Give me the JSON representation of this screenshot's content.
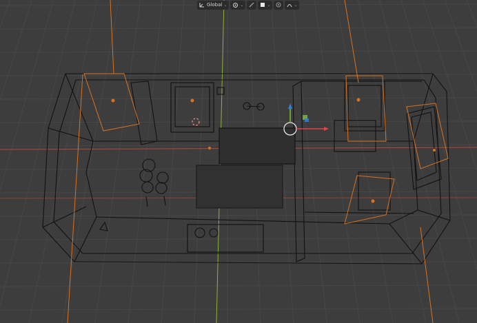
{
  "header": {
    "transform_orientation": {
      "label": "Global",
      "icon": "transform-orientation-icon"
    },
    "pivot_point": {
      "icon": "pivot-point-icon"
    },
    "snapping": {
      "icons": [
        "snap-toggle-icon",
        "snap-target-icon"
      ]
    },
    "proportional_editing": {
      "icons": [
        "proportional-editing-icon",
        "falloff-icon"
      ]
    }
  },
  "viewport": {
    "shading": "wireframe",
    "background": "#3d3d3d",
    "grid_color": "#474747",
    "axis_x_color": "#c8423d",
    "axis_y_color": "#8fb33a",
    "selected_outline_color": "#d9731f",
    "gizmo": {
      "x_color": "#e0424e",
      "y_color": "#7ab93a",
      "z_color": "#2f7fe0"
    }
  }
}
